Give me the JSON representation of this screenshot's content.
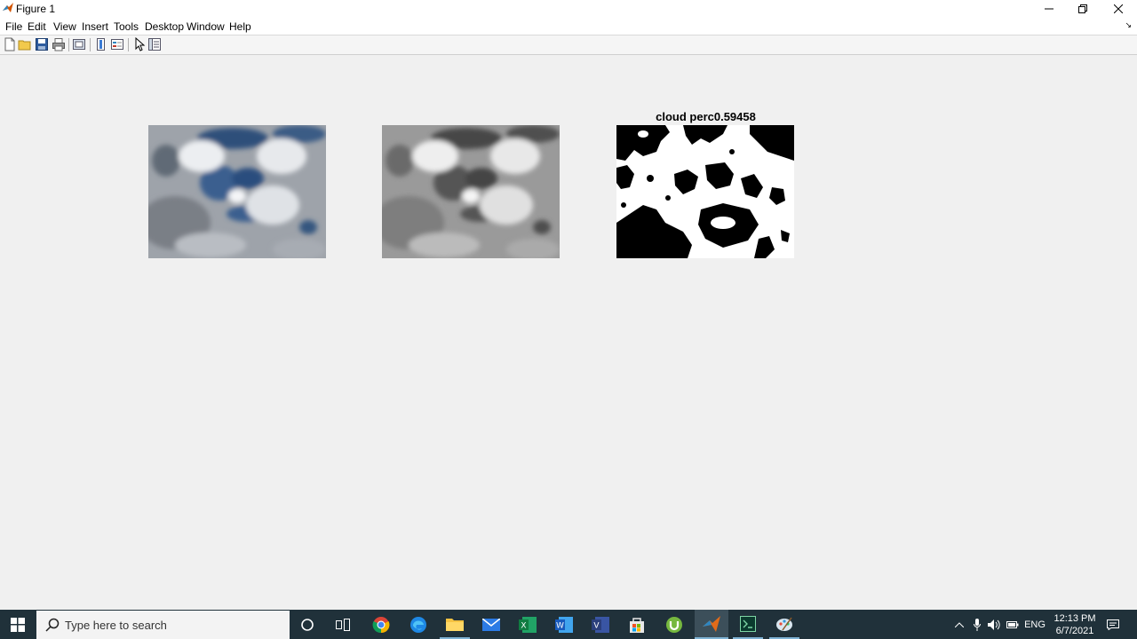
{
  "window": {
    "title": "Figure 1",
    "controls": {
      "minimize": "minimize-icon",
      "restore": "restore-icon",
      "close": "close-icon"
    }
  },
  "menu": {
    "items": [
      "File",
      "Edit",
      "View",
      "Insert",
      "Tools",
      "Desktop",
      "Window",
      "Help"
    ]
  },
  "toolbar": {
    "icons": [
      "new-figure-icon",
      "open-file-icon",
      "save-icon",
      "print-icon",
      "link-plot-icon",
      "colorbar-icon",
      "legend-icon",
      "pointer-icon",
      "property-inspector-icon"
    ]
  },
  "figure": {
    "subplots": [
      {
        "content": "rgb-sky-image",
        "title": ""
      },
      {
        "content": "grayscale-sky-image",
        "title": ""
      },
      {
        "content": "binary-cloud-mask",
        "title": "cloud perc0.59458"
      }
    ]
  },
  "taskbar": {
    "search_placeholder": "Type here to search",
    "apps": [
      "cortana-icon",
      "task-view-icon",
      "chrome-icon",
      "edge-icon",
      "file-explorer-icon",
      "mail-icon",
      "excel-icon",
      "word-icon",
      "visio-icon",
      "store-icon",
      "utorrent-icon",
      "matlab-icon",
      "terminal-icon",
      "paint-icon"
    ],
    "tray": {
      "language": "ENG",
      "time": "12:13 PM",
      "date": "6/7/2021"
    }
  },
  "colors": {
    "taskbar_bg": "#20313a",
    "figure_bg": "#f0f0f0",
    "sky_blue": "#3a5f8f",
    "active_underline": "#7fb3d5"
  }
}
